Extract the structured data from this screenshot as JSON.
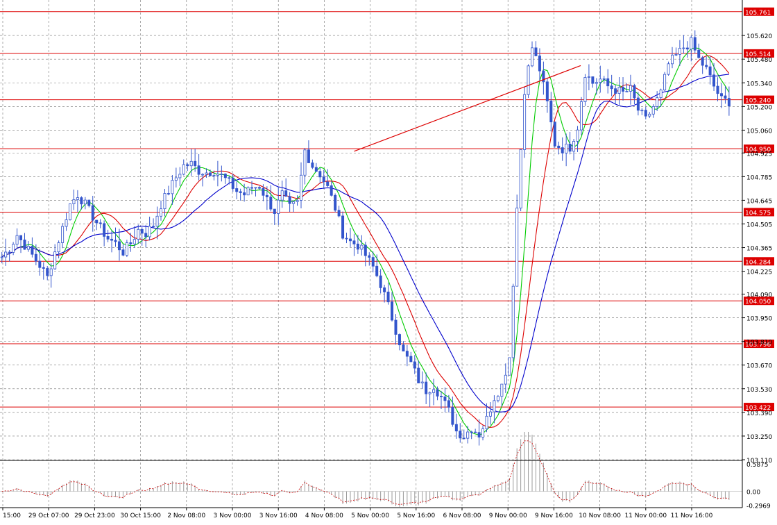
{
  "chart_data": [
    {
      "type": "candlestick",
      "panel": "main",
      "price_scale": {
        "labels": [
          "105.620",
          "105.480",
          "105.340",
          "105.200",
          "105.060",
          "104.925",
          "104.785",
          "104.645",
          "104.505",
          "104.365",
          "104.225",
          "104.090",
          "103.950",
          "103.810",
          "103.670",
          "103.530",
          "103.390",
          "103.250",
          "103.110"
        ],
        "range": [
          103.11,
          105.83
        ]
      },
      "time_labels": [
        "15:00",
        "29 Oct 07:00",
        "29 Oct 23:00",
        "30 Oct 15:00",
        "2 Nov 08:00",
        "3 Nov 00:00",
        "3 Nov 16:00",
        "4 Nov 08:00",
        "5 Nov 00:00",
        "5 Nov 16:00",
        "6 Nov 08:00",
        "9 Nov 00:00",
        "9 Nov 16:00",
        "10 Nov 08:00",
        "11 Nov 00:00",
        "11 Nov 16:00"
      ],
      "horizontal_levels": [
        {
          "value": 105.761,
          "label": "105.761"
        },
        {
          "value": 105.514,
          "label": "105.514"
        },
        {
          "value": 105.24,
          "label": "105.240"
        },
        {
          "value": 104.95,
          "label": "104.950"
        },
        {
          "value": 104.575,
          "label": "104.575"
        },
        {
          "value": 104.284,
          "label": "104.284"
        },
        {
          "value": 104.05,
          "label": "104.050"
        },
        {
          "value": 103.796,
          "label": "103.796"
        },
        {
          "value": 103.422,
          "label": "103.422"
        }
      ],
      "trendline": {
        "start": [
          93,
          104.935
        ],
        "end": [
          140,
          105.335
        ]
      },
      "close_series": [
        [
          0,
          104.31
        ],
        [
          2,
          104.36
        ],
        [
          4,
          104.44
        ],
        [
          6,
          104.38
        ],
        [
          8,
          104.32
        ],
        [
          10,
          104.26
        ],
        [
          12,
          104.19
        ],
        [
          14,
          104.34
        ],
        [
          16,
          104.48
        ],
        [
          18,
          104.62
        ],
        [
          20,
          104.68
        ],
        [
          22,
          104.62
        ],
        [
          24,
          104.55
        ],
        [
          26,
          104.48
        ],
        [
          28,
          104.42
        ],
        [
          30,
          104.39
        ],
        [
          32,
          104.34
        ],
        [
          34,
          104.39
        ],
        [
          36,
          104.47
        ],
        [
          38,
          104.45
        ],
        [
          40,
          104.5
        ],
        [
          42,
          104.62
        ],
        [
          44,
          104.7
        ],
        [
          46,
          104.78
        ],
        [
          48,
          104.85
        ],
        [
          50,
          104.86
        ],
        [
          52,
          104.82
        ],
        [
          54,
          104.81
        ],
        [
          56,
          104.82
        ],
        [
          58,
          104.79
        ],
        [
          60,
          104.75
        ],
        [
          62,
          104.7
        ],
        [
          64,
          104.68
        ],
        [
          66,
          104.72
        ],
        [
          68,
          104.73
        ],
        [
          70,
          104.65
        ],
        [
          72,
          104.58
        ],
        [
          74,
          104.68
        ],
        [
          76,
          104.6
        ],
        [
          78,
          104.63
        ],
        [
          80,
          104.94
        ],
        [
          82,
          104.85
        ],
        [
          84,
          104.8
        ],
        [
          86,
          104.72
        ],
        [
          88,
          104.6
        ],
        [
          90,
          104.45
        ],
        [
          92,
          104.4
        ],
        [
          94,
          104.38
        ],
        [
          96,
          104.32
        ],
        [
          98,
          104.25
        ],
        [
          100,
          104.15
        ],
        [
          102,
          104.02
        ],
        [
          104,
          103.88
        ],
        [
          106,
          103.74
        ],
        [
          108,
          103.68
        ],
        [
          110,
          103.58
        ],
        [
          112,
          103.52
        ],
        [
          114,
          103.55
        ],
        [
          116,
          103.48
        ],
        [
          118,
          103.4
        ],
        [
          120,
          103.28
        ],
        [
          122,
          103.25
        ],
        [
          124,
          103.3
        ],
        [
          126,
          103.26
        ],
        [
          128,
          103.35
        ],
        [
          130,
          103.48
        ],
        [
          132,
          103.55
        ],
        [
          134,
          103.72
        ],
        [
          136,
          104.6
        ],
        [
          138,
          105.3
        ],
        [
          140,
          105.55
        ],
        [
          142,
          105.42
        ],
        [
          144,
          105.22
        ],
        [
          146,
          104.98
        ],
        [
          148,
          104.95
        ],
        [
          150,
          104.96
        ],
        [
          152,
          105.08
        ],
        [
          154,
          105.4
        ],
        [
          156,
          105.34
        ],
        [
          158,
          105.36
        ],
        [
          160,
          105.32
        ],
        [
          162,
          105.3
        ],
        [
          164,
          105.28
        ],
        [
          166,
          105.3
        ],
        [
          168,
          105.18
        ],
        [
          170,
          105.12
        ],
        [
          172,
          105.2
        ],
        [
          174,
          105.28
        ],
        [
          176,
          105.45
        ],
        [
          178,
          105.5
        ],
        [
          180,
          105.55
        ],
        [
          182,
          105.58
        ],
        [
          184,
          105.48
        ],
        [
          186,
          105.42
        ],
        [
          188,
          105.32
        ],
        [
          190,
          105.24
        ],
        [
          192,
          105.23
        ]
      ],
      "moving_averages": [
        {
          "color": "#00cc00",
          "period_bars": 6
        },
        {
          "color": "#dd0000",
          "period_bars": 12
        },
        {
          "color": "#0000cc",
          "period_bars": 22
        }
      ]
    },
    {
      "type": "histogram",
      "panel": "indicator",
      "scale_labels": [
        "0.5875",
        "0.00",
        "-0.2969"
      ],
      "range": [
        -0.35,
        0.65
      ],
      "signal_color": "#cc0000"
    }
  ],
  "colors": {
    "background": "#ffffff",
    "grid": "#000000",
    "candle": "#3355cc",
    "level": "#dd0000",
    "level_label_bg": "#dd0000",
    "level_label_text": "#ffffff",
    "axis_text": "#000000",
    "histogram": "#999999"
  }
}
